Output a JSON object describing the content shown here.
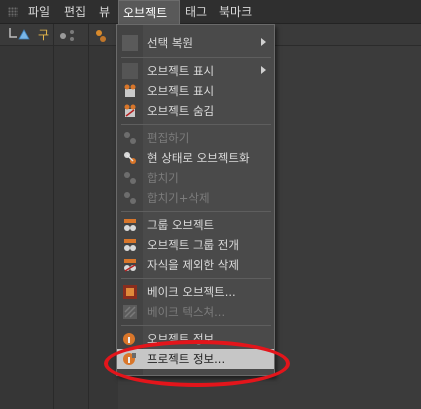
{
  "menubar": {
    "items": [
      {
        "label": "파일"
      },
      {
        "label": "편집"
      },
      {
        "label": "뷰"
      },
      {
        "label": "오브젝트"
      },
      {
        "label": "태그"
      },
      {
        "label": "북마크"
      }
    ]
  },
  "toolbar": {
    "tree_label": "구"
  },
  "menu": {
    "items": [
      {
        "label": "선택 복원"
      },
      {
        "label": "오브젝트 표시"
      },
      {
        "label": "오브젝트 표시"
      },
      {
        "label": "오브젝트 숨김"
      },
      {
        "label": "편집하기"
      },
      {
        "label": "현 상태로 오브젝트화"
      },
      {
        "label": "합치기"
      },
      {
        "label": "합치기+삭제"
      },
      {
        "label": "그룹 오브젝트"
      },
      {
        "label": "오브젝트 그룹 전개"
      },
      {
        "label": "자식을 제외한 삭제"
      },
      {
        "label": "베이크 오브젝트..."
      },
      {
        "label": "베이크 텍스쳐..."
      },
      {
        "label": "오브젝트 정보..."
      },
      {
        "label": "프로젝트 정보..."
      }
    ]
  },
  "colors": {
    "menubar_bg": "#2f2f2f",
    "dropdown_bg": "#4a4a4a",
    "highlight": "#c6c6c6",
    "annotation": "#e3151b"
  }
}
